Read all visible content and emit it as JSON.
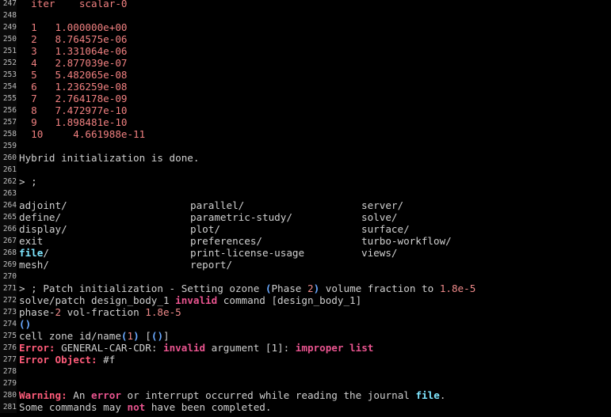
{
  "colors": {
    "background": "#000000",
    "text": "#d0d0d0",
    "numeric_output": "#f08080",
    "error_keyword": "#ff5c7a",
    "invalid_keyword": "#e9548f",
    "paren": "#6aa9ff",
    "highlight_word": "#7fe6ff"
  },
  "lines": [
    {
      "n": "247",
      "segs": [
        {
          "t": "  iter    scalar-0",
          "c": "salmon"
        }
      ]
    },
    {
      "n": "248",
      "segs": []
    },
    {
      "n": "249",
      "segs": [
        {
          "t": "  1   1.000000e+00",
          "c": "salmon"
        }
      ]
    },
    {
      "n": "250",
      "segs": [
        {
          "t": "  2   8.764575e-06",
          "c": "salmon"
        }
      ]
    },
    {
      "n": "251",
      "segs": [
        {
          "t": "  3   1.331064e-06",
          "c": "salmon"
        }
      ]
    },
    {
      "n": "252",
      "segs": [
        {
          "t": "  4   2.877039e-07",
          "c": "salmon"
        }
      ]
    },
    {
      "n": "253",
      "segs": [
        {
          "t": "  5   5.482065e-08",
          "c": "salmon"
        }
      ]
    },
    {
      "n": "254",
      "segs": [
        {
          "t": "  6   1.236259e-08",
          "c": "salmon"
        }
      ]
    },
    {
      "n": "255",
      "segs": [
        {
          "t": "  7   2.764178e-09",
          "c": "salmon"
        }
      ]
    },
    {
      "n": "256",
      "segs": [
        {
          "t": "  8   7.472977e-10",
          "c": "salmon"
        }
      ]
    },
    {
      "n": "257",
      "segs": [
        {
          "t": "  9   1.898481e-10",
          "c": "salmon"
        }
      ]
    },
    {
      "n": "258",
      "segs": [
        {
          "t": "  10     4.661988e-11",
          "c": "salmon"
        }
      ]
    },
    {
      "n": "259",
      "segs": []
    },
    {
      "n": "260",
      "segs": [
        {
          "t": "Hybrid initialization is done.",
          "c": "default"
        }
      ]
    },
    {
      "n": "261",
      "segs": []
    },
    {
      "n": "262",
      "segs": [
        {
          "t": "> ;",
          "c": "default"
        }
      ]
    },
    {
      "n": "263",
      "segs": []
    },
    {
      "n": "264",
      "cols": [
        {
          "t": "adjoint/",
          "c": "default"
        },
        {
          "t": "parallel/",
          "c": "default"
        },
        {
          "t": "server/",
          "c": "default"
        }
      ]
    },
    {
      "n": "265",
      "cols": [
        {
          "t": "define/",
          "c": "default"
        },
        {
          "t": "parametric-study/",
          "c": "default"
        },
        {
          "t": "solve/",
          "c": "default"
        }
      ]
    },
    {
      "n": "266",
      "cols": [
        {
          "t": "display/",
          "c": "default"
        },
        {
          "t": "plot/",
          "c": "default"
        },
        {
          "t": "surface/",
          "c": "default"
        }
      ]
    },
    {
      "n": "267",
      "cols": [
        {
          "t": "exit",
          "c": "default"
        },
        {
          "t": "preferences/",
          "c": "default"
        },
        {
          "t": "turbo-workflow/",
          "c": "default"
        }
      ]
    },
    {
      "n": "268",
      "cols": [
        {
          "t": "file/",
          "c": "cyan",
          "t2": ""
        },
        {
          "t": "print-license-usage",
          "c": "default"
        },
        {
          "t": "views/",
          "c": "default"
        }
      ]
    },
    {
      "n": "269",
      "cols": [
        {
          "t": "mesh/",
          "c": "default"
        },
        {
          "t": "report/",
          "c": "default"
        }
      ]
    },
    {
      "n": "270",
      "segs": []
    },
    {
      "n": "271",
      "segs": [
        {
          "t": "> ; Patch initialization - Setting ozone ",
          "c": "default"
        },
        {
          "t": "(",
          "c": "paren"
        },
        {
          "t": "Phase ",
          "c": "default"
        },
        {
          "t": "2",
          "c": "num"
        },
        {
          "t": ")",
          "c": "paren"
        },
        {
          "t": " volume fraction to ",
          "c": "default"
        },
        {
          "t": "1.8e-5",
          "c": "num"
        }
      ]
    },
    {
      "n": "272",
      "segs": [
        {
          "t": "solve/patch design_body_1 ",
          "c": "default"
        },
        {
          "t": "invalid",
          "c": "kw"
        },
        {
          "t": " command [design_body_1]",
          "c": "default"
        }
      ]
    },
    {
      "n": "273",
      "segs": [
        {
          "t": "phase-",
          "c": "default"
        },
        {
          "t": "2",
          "c": "num"
        },
        {
          "t": " vol-fraction ",
          "c": "default"
        },
        {
          "t": "1.8e-5",
          "c": "num"
        }
      ]
    },
    {
      "n": "274",
      "segs": [
        {
          "t": "()",
          "c": "paren"
        }
      ]
    },
    {
      "n": "275",
      "segs": [
        {
          "t": "cell zone id/name",
          "c": "default"
        },
        {
          "t": "(",
          "c": "paren"
        },
        {
          "t": "1",
          "c": "num"
        },
        {
          "t": ")",
          "c": "paren"
        },
        {
          "t": " [",
          "c": "default"
        },
        {
          "t": "()",
          "c": "paren"
        },
        {
          "t": "]",
          "c": "default"
        }
      ]
    },
    {
      "n": "276",
      "segs": [
        {
          "t": "Error:",
          "c": "err"
        },
        {
          "t": " GENERAL-CAR-CDR: ",
          "c": "default"
        },
        {
          "t": "invalid",
          "c": "kw"
        },
        {
          "t": " argument [1]: ",
          "c": "default"
        },
        {
          "t": "improper list",
          "c": "kw"
        }
      ]
    },
    {
      "n": "277",
      "segs": [
        {
          "t": "Error Object:",
          "c": "err"
        },
        {
          "t": " #f",
          "c": "default"
        }
      ]
    },
    {
      "n": "278",
      "segs": []
    },
    {
      "n": "279",
      "segs": []
    },
    {
      "n": "280",
      "segs": [
        {
          "t": "Warning:",
          "c": "err"
        },
        {
          "t": " An ",
          "c": "default"
        },
        {
          "t": "error",
          "c": "kw"
        },
        {
          "t": " or interrupt occurred while reading the journal ",
          "c": "default"
        },
        {
          "t": "file",
          "c": "cyan"
        },
        {
          "t": ".",
          "c": "default"
        }
      ]
    },
    {
      "n": "281",
      "segs": [
        {
          "t": "Some commands may ",
          "c": "default"
        },
        {
          "t": "not",
          "c": "kw"
        },
        {
          "t": " have been completed.",
          "c": "default"
        }
      ]
    }
  ]
}
